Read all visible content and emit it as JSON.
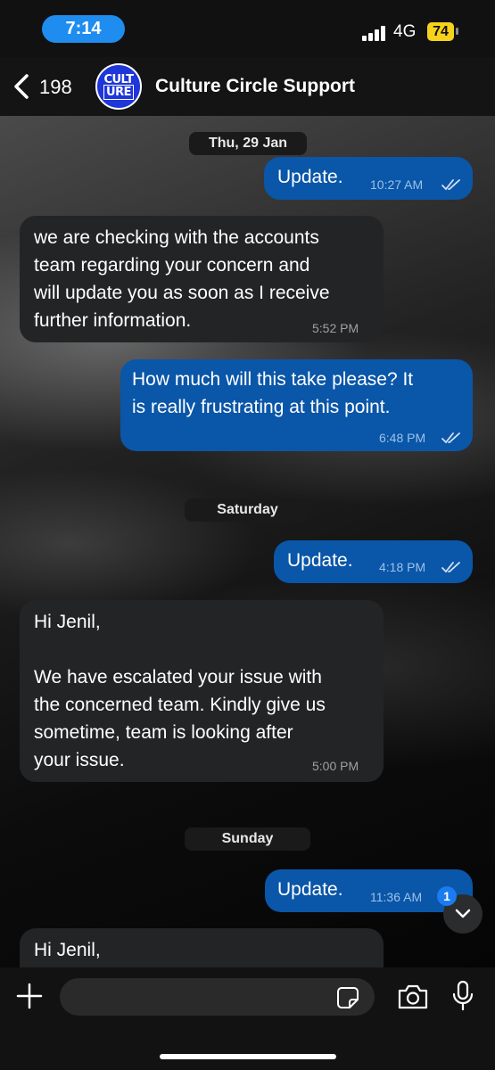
{
  "status_bar": {
    "time": "7:14",
    "network": "4G",
    "battery": "74"
  },
  "header": {
    "unread_count": "198",
    "avatar_line1": "CULT",
    "avatar_line2": "URE",
    "contact_name": "Culture Circle Support"
  },
  "dates": {
    "d1": "Thu, 29 Jan",
    "d2": "Saturday",
    "d3": "Sunday"
  },
  "messages": [
    {
      "direction": "out",
      "text": "Update.",
      "time": "10:27 AM",
      "status": "read"
    },
    {
      "direction": "in",
      "text": "we are  checking with the accounts\nteam regarding your concern and\nwill update you as soon as I receive\nfurther information.",
      "time": "5:52 PM"
    },
    {
      "direction": "out",
      "text": "How much will this take please? It\nis really frustrating at this point.",
      "time": "6:48 PM",
      "status": "read"
    },
    {
      "direction": "out",
      "text": "Update.",
      "time": "4:18 PM",
      "status": "read"
    },
    {
      "direction": "in",
      "text": "Hi Jenil,\n\nWe have escalated your issue with\nthe concerned team. Kindly give us\nsometime, team is looking after\nyour issue.",
      "time": "5:00 PM"
    },
    {
      "direction": "out",
      "text": "Update.",
      "time": "11:36 AM",
      "status": "read"
    },
    {
      "direction": "in",
      "text": "Hi Jenil,",
      "time": ""
    }
  ],
  "scroll_badge": "1",
  "composer": {
    "placeholder": ""
  },
  "colors": {
    "outgoing": "#0a56a8",
    "incoming": "#232425",
    "accent": "#1f8cf0",
    "battery": "#f6d21c"
  }
}
